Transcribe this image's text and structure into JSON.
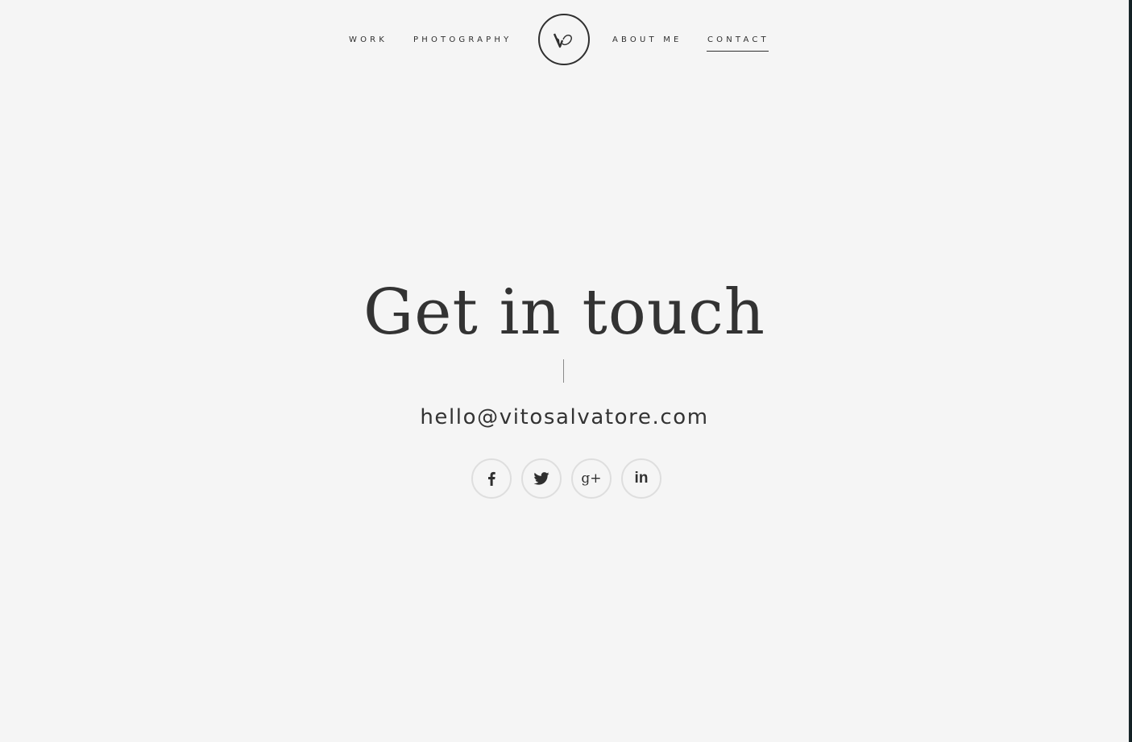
{
  "nav": {
    "items": [
      {
        "label": "WORK"
      },
      {
        "label": "PHOTOGRAPHY"
      },
      {
        "label": "ABOUT ME"
      },
      {
        "label": "CONTACT",
        "active": true
      }
    ],
    "logo_icon": "vs-monogram-logo"
  },
  "main": {
    "title": "Get in touch",
    "email": "hello@vitosalvatore.com"
  },
  "social": [
    {
      "icon": "facebook-icon"
    },
    {
      "icon": "twitter-icon"
    },
    {
      "icon": "google-plus-icon",
      "glyph": "g+"
    },
    {
      "icon": "linkedin-icon",
      "glyph": "in"
    }
  ],
  "colors": {
    "background": "#f5f5f5",
    "text": "#333333",
    "circle_border": "#dedede"
  }
}
